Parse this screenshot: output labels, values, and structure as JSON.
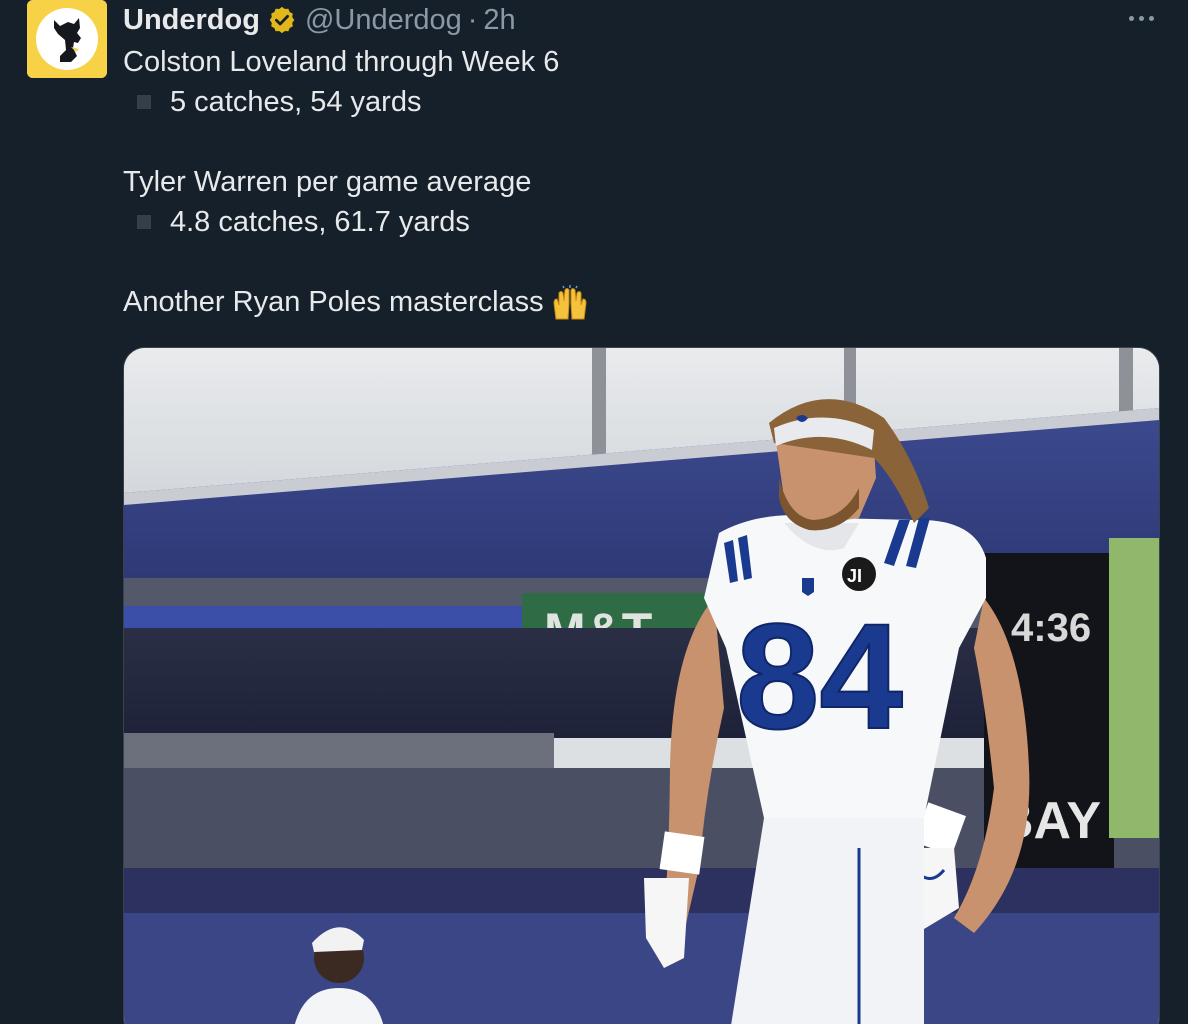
{
  "author": {
    "display_name": "Underdog",
    "handle": "@Underdog",
    "separator": "·",
    "time": "2h",
    "verified": true
  },
  "tweet": {
    "line1": "Colston Loveland through Week 6",
    "line2": "5 catches, 54 yards",
    "line3": "Tyler Warren per game average",
    "line4": "4.8 catches, 61.7 yards",
    "line5": "Another Ryan Poles masterclass"
  },
  "media": {
    "jersey_number": "84",
    "scoreboard_time": "4:36",
    "banner_text": "BAY",
    "stadium_sign": "M&T",
    "patch_text": "JI"
  },
  "icons": {
    "avatar": "underdog-dog-logo",
    "verified": "verified-badge-icon",
    "more": "more-icon",
    "emoji": "raised-hands-emoji"
  },
  "colors": {
    "background": "#15202b",
    "text": "#e7e9ea",
    "muted": "#8b98a5",
    "verified_gold": "#e2b719",
    "avatar_bg": "#f7d247",
    "colts_blue": "#1a3a8f"
  }
}
